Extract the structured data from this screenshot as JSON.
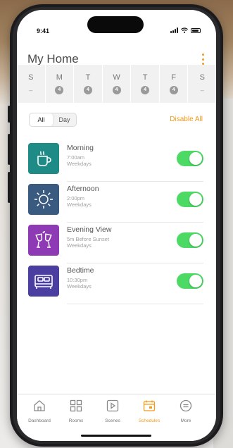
{
  "status_bar": {
    "time": "9:41"
  },
  "header": {
    "title": "My Home"
  },
  "days": [
    {
      "letter": "S",
      "badge": "–"
    },
    {
      "letter": "M",
      "badge": "4"
    },
    {
      "letter": "T",
      "badge": "4"
    },
    {
      "letter": "W",
      "badge": "4"
    },
    {
      "letter": "T",
      "badge": "4"
    },
    {
      "letter": "F",
      "badge": "4"
    },
    {
      "letter": "S",
      "badge": "–"
    }
  ],
  "filter": {
    "all_label": "All",
    "day_label": "Day",
    "selected": "All",
    "disable_all_label": "Disable All"
  },
  "schedules": [
    {
      "name": "Morning",
      "time": "7:00am",
      "days": "Weekdays",
      "icon": "coffee-mug-icon",
      "color": "#1f8b87",
      "enabled": true
    },
    {
      "name": "Afternoon",
      "time": "2:00pm",
      "days": "Weekdays",
      "icon": "sun-icon",
      "color": "#3b5a80",
      "enabled": true
    },
    {
      "name": "Evening View",
      "time": "5m Before Sunset",
      "days": "Weekdays",
      "icon": "wine-glasses-icon",
      "color": "#8e3ab5",
      "enabled": true
    },
    {
      "name": "Bedtime",
      "time": "10:30pm",
      "days": "Weekdays",
      "icon": "bed-icon",
      "color": "#4a3fa0",
      "enabled": true
    }
  ],
  "tabs": [
    {
      "label": "Dashboard",
      "icon": "home-icon",
      "active": false
    },
    {
      "label": "Rooms",
      "icon": "grid-icon",
      "active": false
    },
    {
      "label": "Scenes",
      "icon": "play-icon",
      "active": false
    },
    {
      "label": "Schedules",
      "icon": "calendar-icon",
      "active": true
    },
    {
      "label": "More",
      "icon": "more-icon",
      "active": false
    }
  ],
  "colors": {
    "accent": "#f29a1a",
    "toggle_on": "#4cd964"
  }
}
